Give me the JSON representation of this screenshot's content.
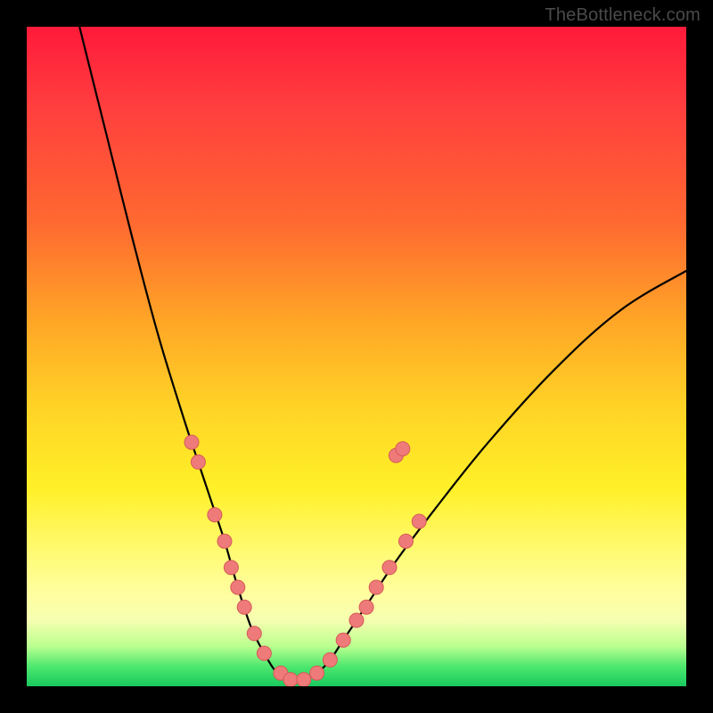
{
  "watermark": "TheBottleneck.com",
  "colors": {
    "curve": "#000000",
    "marker_fill": "#ee7b79",
    "marker_stroke": "#d65a58"
  },
  "chart_data": {
    "type": "line",
    "title": "",
    "xlabel": "",
    "ylabel": "",
    "xlim": [
      0,
      100
    ],
    "ylim": [
      0,
      100
    ],
    "series": [
      {
        "name": "curve",
        "x": [
          8,
          12,
          16,
          20,
          24,
          26,
          28,
          30,
          32,
          34,
          36,
          38,
          40,
          42,
          44,
          46,
          48,
          52,
          56,
          62,
          70,
          80,
          90,
          100
        ],
        "y": [
          100,
          84,
          68,
          53,
          40,
          34,
          28,
          22,
          15,
          9,
          5,
          2,
          1,
          1,
          2,
          4,
          7,
          13,
          19,
          27,
          37,
          48,
          57,
          63
        ]
      }
    ],
    "markers": [
      {
        "x": 25.0,
        "y": 37
      },
      {
        "x": 26.0,
        "y": 34
      },
      {
        "x": 28.5,
        "y": 26
      },
      {
        "x": 30.0,
        "y": 22
      },
      {
        "x": 31.0,
        "y": 18
      },
      {
        "x": 32.0,
        "y": 15
      },
      {
        "x": 33.0,
        "y": 12
      },
      {
        "x": 34.5,
        "y": 8
      },
      {
        "x": 36.0,
        "y": 5
      },
      {
        "x": 38.5,
        "y": 2
      },
      {
        "x": 40.0,
        "y": 1
      },
      {
        "x": 42.0,
        "y": 1
      },
      {
        "x": 44.0,
        "y": 2
      },
      {
        "x": 46.0,
        "y": 4
      },
      {
        "x": 48.0,
        "y": 7
      },
      {
        "x": 50.0,
        "y": 10
      },
      {
        "x": 51.5,
        "y": 12
      },
      {
        "x": 53.0,
        "y": 15
      },
      {
        "x": 55.0,
        "y": 18
      },
      {
        "x": 57.5,
        "y": 22
      },
      {
        "x": 59.5,
        "y": 25
      },
      {
        "x": 56.0,
        "y": 35
      },
      {
        "x": 57.0,
        "y": 36
      }
    ]
  }
}
